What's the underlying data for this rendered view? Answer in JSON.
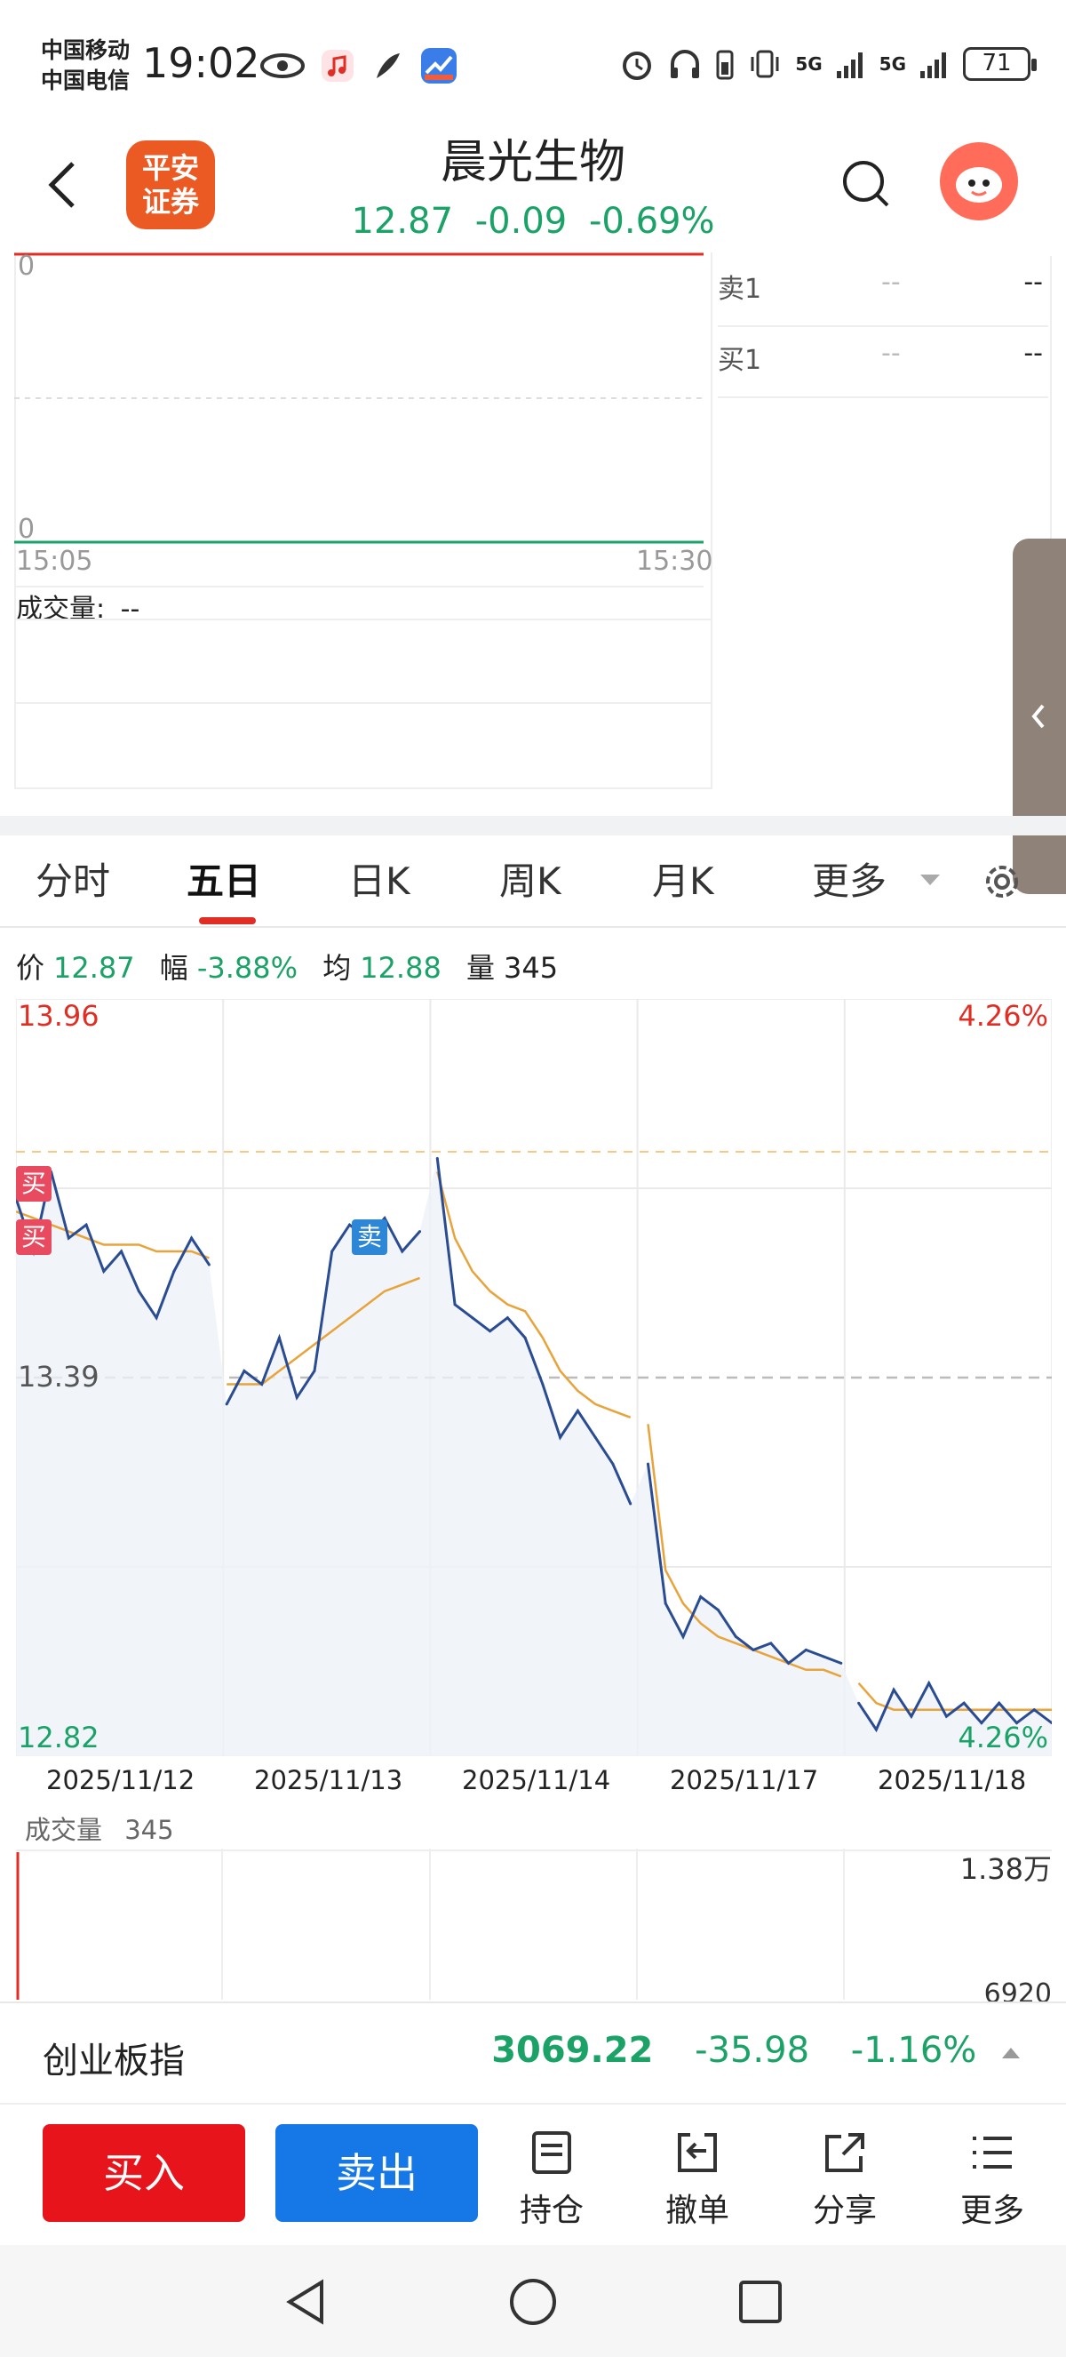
{
  "status": {
    "carrier1": "中国移动",
    "carrier2": "中国电信",
    "time": "19:02",
    "net1": "5G",
    "net2": "5G",
    "battery": "71"
  },
  "header": {
    "logo_line1": "平安",
    "logo_line2": "证券",
    "title": "晨光生物",
    "price": "12.87",
    "change": "-0.09",
    "change_pct": "-0.69%",
    "icons": [
      "back-arrow-icon",
      "search-icon",
      "avatar"
    ]
  },
  "intraday": {
    "top_value": "0",
    "bottom_value": "0",
    "time_start": "15:05",
    "time_end": "15:30",
    "volume_label": "成交量:",
    "volume_value": "--",
    "orders": [
      {
        "label": "卖1",
        "price": "--",
        "volume": "--"
      },
      {
        "label": "买1",
        "price": "--",
        "volume": "--"
      }
    ]
  },
  "tabs": [
    {
      "label": "分时",
      "active": false
    },
    {
      "label": "五日",
      "active": true
    },
    {
      "label": "日K",
      "active": false
    },
    {
      "label": "周K",
      "active": false
    },
    {
      "label": "月K",
      "active": false
    },
    {
      "label": "更多",
      "active": false
    }
  ],
  "info": {
    "price_label": "价",
    "price": "12.87",
    "range_label": "幅",
    "range": "-3.88%",
    "avg_label": "均",
    "avg": "12.88",
    "vol_label": "量",
    "vol": "345"
  },
  "chart_data": {
    "type": "line",
    "y_high": "13.96",
    "y_mid": "13.39",
    "y_low": "12.82",
    "pct_high": "4.26%",
    "pct_low": "4.26%",
    "dates": [
      "2025/11/12",
      "2025/11/13",
      "2025/11/14",
      "2025/11/17",
      "2025/11/18"
    ],
    "ylim": [
      12.82,
      13.96
    ],
    "series": [
      {
        "role": "price",
        "color": "#2a4c93",
        "values": [
          13.66,
          13.58,
          13.7,
          13.6,
          13.62,
          13.55,
          13.58,
          13.52,
          13.48,
          13.55,
          13.6,
          13.56,
          13.35,
          13.4,
          13.38,
          13.45,
          13.36,
          13.4,
          13.58,
          13.62,
          13.6,
          13.63,
          13.58,
          13.61,
          13.72,
          13.5,
          13.48,
          13.46,
          13.48,
          13.45,
          13.38,
          13.3,
          13.34,
          13.3,
          13.26,
          13.2,
          13.26,
          13.05,
          13.0,
          13.06,
          13.04,
          13.0,
          12.98,
          12.99,
          12.96,
          12.98,
          12.97,
          12.96,
          12.9,
          12.86,
          12.92,
          12.88,
          12.93,
          12.88,
          12.9,
          12.87,
          12.9,
          12.87,
          12.89,
          12.87
        ]
      },
      {
        "role": "average",
        "color": "#e8a33a",
        "values": [
          13.64,
          13.63,
          13.62,
          13.61,
          13.6,
          13.59,
          13.59,
          13.59,
          13.58,
          13.58,
          13.58,
          13.57,
          13.38,
          13.38,
          13.38,
          13.4,
          13.42,
          13.44,
          13.46,
          13.48,
          13.5,
          13.52,
          13.53,
          13.54,
          13.7,
          13.6,
          13.55,
          13.52,
          13.5,
          13.49,
          13.45,
          13.4,
          13.37,
          13.35,
          13.34,
          13.33,
          13.32,
          13.1,
          13.05,
          13.02,
          13.0,
          12.99,
          12.98,
          12.97,
          12.96,
          12.95,
          12.95,
          12.94,
          12.93,
          12.9,
          12.89,
          12.89,
          12.89,
          12.89,
          12.89,
          12.89,
          12.89,
          12.89,
          12.89,
          12.89
        ]
      }
    ],
    "markers": [
      {
        "label": "买",
        "kind": "buy"
      },
      {
        "label": "买",
        "kind": "buy"
      },
      {
        "label": "卖",
        "kind": "sell"
      }
    ],
    "volume": {
      "title": "成交量",
      "value": "345",
      "max_label": "1.38万",
      "mid_label": "6920"
    }
  },
  "index": {
    "name": "创业板指",
    "value": "3069.22",
    "change": "-35.98",
    "change_pct": "-1.16%"
  },
  "actions": {
    "buy": "买入",
    "sell": "卖出",
    "items": [
      {
        "label": "持仓",
        "icon": "holdings-icon"
      },
      {
        "label": "撤单",
        "icon": "cancel-order-icon"
      },
      {
        "label": "分享",
        "icon": "share-icon"
      },
      {
        "label": "更多",
        "icon": "menu-icon"
      }
    ]
  },
  "colors": {
    "red": "#e02e24",
    "green": "#1aa267",
    "blue_button": "#1677e6",
    "price_line": "#2a4c93",
    "avg_line": "#e8a33a"
  }
}
